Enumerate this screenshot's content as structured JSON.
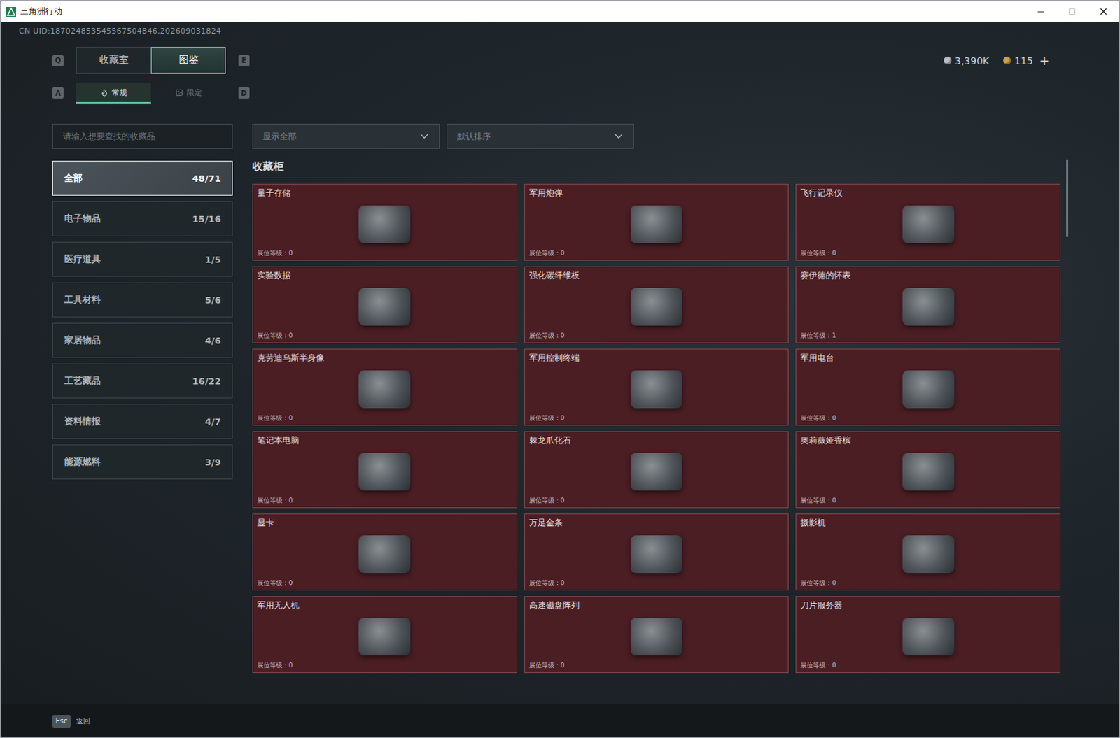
{
  "window": {
    "title": "三角洲行动"
  },
  "uid": "CN UID:187024853545567504846,202609031824",
  "currency": [
    {
      "value": "3,390K",
      "color": "#b9bcc0"
    },
    {
      "value": "115",
      "color": "#c9a24a"
    }
  ],
  "currency_add": "+",
  "tabs": {
    "prev_key": "Q",
    "next_key": "E",
    "items": [
      {
        "label": "收藏室",
        "selected": false
      },
      {
        "label": "图鉴",
        "selected": true
      }
    ]
  },
  "subtabs": {
    "prev_key": "A",
    "next_key": "D",
    "items": [
      {
        "label": "常规",
        "selected": true
      },
      {
        "label": "限定",
        "selected": false
      }
    ]
  },
  "search": {
    "placeholder": "请输入想要查找的收藏品"
  },
  "filters": [
    {
      "value": "显示全部"
    },
    {
      "value": "默认排序"
    }
  ],
  "sidebar": {
    "items": [
      {
        "label": "全部",
        "count": "48/71",
        "selected": true
      },
      {
        "label": "电子物品",
        "count": "15/16",
        "selected": false
      },
      {
        "label": "医疗道具",
        "count": "1/5",
        "selected": false
      },
      {
        "label": "工具材料",
        "count": "5/6",
        "selected": false
      },
      {
        "label": "家居物品",
        "count": "4/6",
        "selected": false
      },
      {
        "label": "工艺藏品",
        "count": "16/22",
        "selected": false
      },
      {
        "label": "资料情报",
        "count": "4/7",
        "selected": false
      },
      {
        "label": "能源燃料",
        "count": "3/9",
        "selected": false
      }
    ]
  },
  "section": {
    "title": "收藏柜"
  },
  "cards": [
    {
      "name": "量子存储",
      "grade": "展位等级：0"
    },
    {
      "name": "军用炮弹",
      "grade": "展位等级：0"
    },
    {
      "name": "飞行记录仪",
      "grade": "展位等级：0"
    },
    {
      "name": "实验数据",
      "grade": "展位等级：0"
    },
    {
      "name": "强化碳纤维板",
      "grade": "展位等级：0"
    },
    {
      "name": "赛伊德的怀表",
      "grade": "展位等级：1"
    },
    {
      "name": "克劳迪乌斯半身像",
      "grade": "展位等级：0"
    },
    {
      "name": "军用控制终端",
      "grade": "展位等级：0"
    },
    {
      "name": "军用电台",
      "grade": "展位等级：0"
    },
    {
      "name": "笔记本电脑",
      "grade": "展位等级：0"
    },
    {
      "name": "棘龙爪化石",
      "grade": "展位等级：0"
    },
    {
      "name": "奥莉薇娅香槟",
      "grade": "展位等级：0"
    },
    {
      "name": "显卡",
      "grade": "展位等级：0"
    },
    {
      "name": "万足金条",
      "grade": "展位等级：0"
    },
    {
      "name": "摄影机",
      "grade": "展位等级：0"
    },
    {
      "name": "军用无人机",
      "grade": "展位等级：0"
    },
    {
      "name": "高速磁盘阵列",
      "grade": "展位等级：0"
    },
    {
      "name": "刀片服务器",
      "grade": "展位等级：0"
    }
  ],
  "footer": {
    "key": "Esc",
    "label": "返回"
  }
}
